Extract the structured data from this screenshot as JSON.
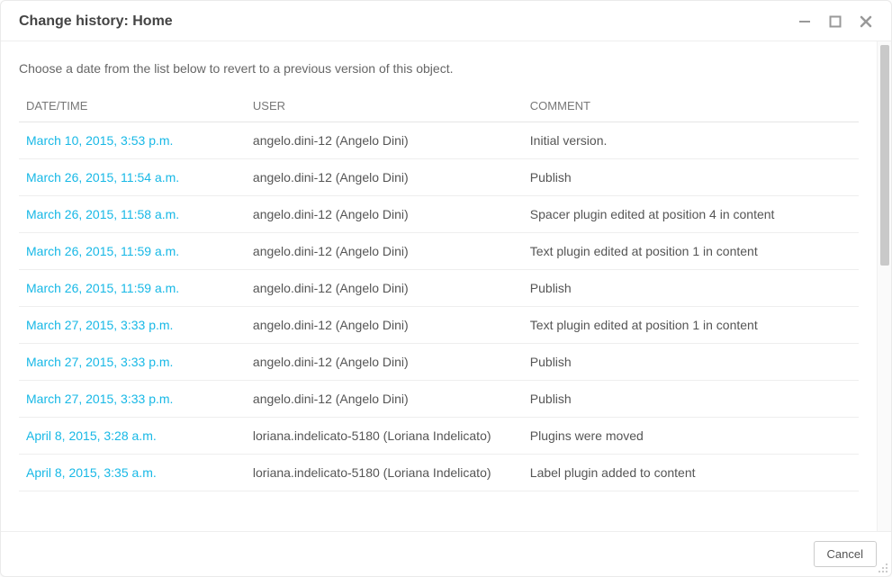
{
  "title": "Change history: Home",
  "instruction": "Choose a date from the list below to revert to a previous version of this object.",
  "columns": {
    "date": "DATE/TIME",
    "user": "USER",
    "comment": "COMMENT"
  },
  "rows": [
    {
      "date": "March 10, 2015, 3:53 p.m.",
      "user": "angelo.dini-12 (Angelo Dini)",
      "comment": "Initial version."
    },
    {
      "date": "March 26, 2015, 11:54 a.m.",
      "user": "angelo.dini-12 (Angelo Dini)",
      "comment": "Publish"
    },
    {
      "date": "March 26, 2015, 11:58 a.m.",
      "user": "angelo.dini-12 (Angelo Dini)",
      "comment": "Spacer plugin edited at position 4 in content"
    },
    {
      "date": "March 26, 2015, 11:59 a.m.",
      "user": "angelo.dini-12 (Angelo Dini)",
      "comment": "Text plugin edited at position 1 in content"
    },
    {
      "date": "March 26, 2015, 11:59 a.m.",
      "user": "angelo.dini-12 (Angelo Dini)",
      "comment": "Publish"
    },
    {
      "date": "March 27, 2015, 3:33 p.m.",
      "user": "angelo.dini-12 (Angelo Dini)",
      "comment": "Text plugin edited at position 1 in content"
    },
    {
      "date": "March 27, 2015, 3:33 p.m.",
      "user": "angelo.dini-12 (Angelo Dini)",
      "comment": "Publish"
    },
    {
      "date": "March 27, 2015, 3:33 p.m.",
      "user": "angelo.dini-12 (Angelo Dini)",
      "comment": "Publish"
    },
    {
      "date": "April 8, 2015, 3:28 a.m.",
      "user": "loriana.indelicato-5180 (Loriana Indelicato)",
      "comment": "Plugins were moved"
    },
    {
      "date": "April 8, 2015, 3:35 a.m.",
      "user": "loriana.indelicato-5180 (Loriana Indelicato)",
      "comment": "Label plugin added to content"
    }
  ],
  "footer": {
    "cancel": "Cancel"
  }
}
